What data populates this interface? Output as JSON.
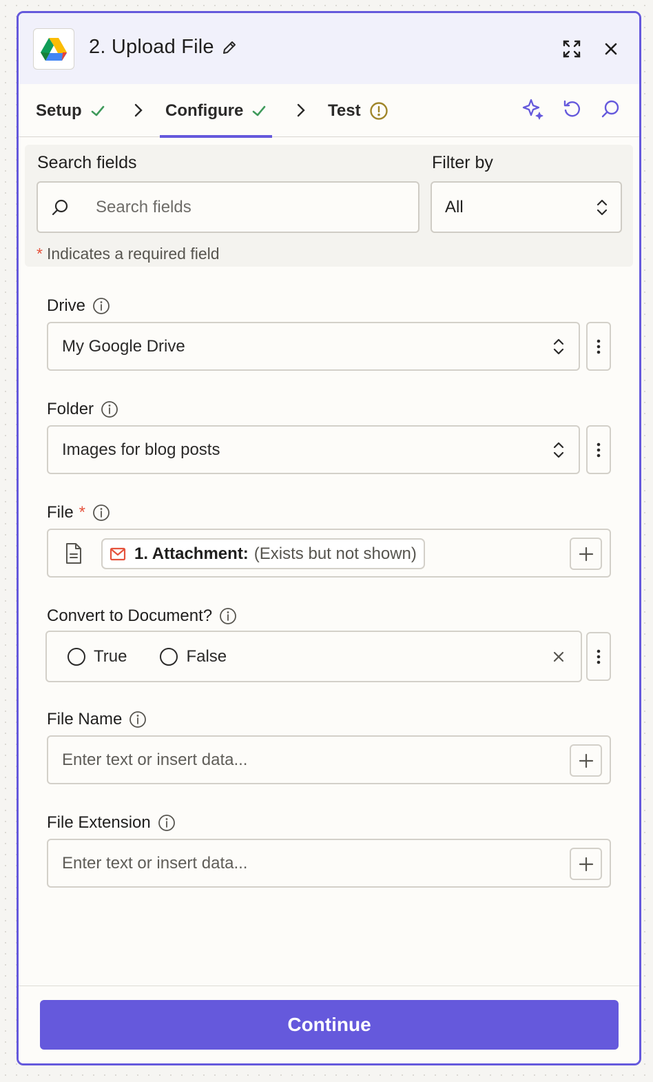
{
  "header": {
    "title": "2. Upload File",
    "app_icon": "google-drive-logo",
    "actions": [
      "expand-icon",
      "close-icon"
    ]
  },
  "tabs": [
    {
      "label": "Setup",
      "status": "complete"
    },
    {
      "label": "Configure",
      "status": "complete",
      "active": true
    },
    {
      "label": "Test",
      "status": "warning"
    }
  ],
  "toolbar": [
    "ai-sparkle-icon",
    "refresh-icon",
    "search-icon"
  ],
  "search": {
    "label": "Search fields",
    "placeholder": "Search fields",
    "filter_label": "Filter by",
    "filter_value": "All",
    "required_note": "Indicates a required field",
    "required_marker": "*"
  },
  "fields": {
    "drive": {
      "label": "Drive",
      "value": "My Google Drive"
    },
    "folder": {
      "label": "Folder",
      "value": "Images for blog posts"
    },
    "file": {
      "label": "File",
      "required_marker": "*",
      "pill_key": "1. Attachment:",
      "pill_value": "(Exists but not shown)"
    },
    "convert": {
      "label": "Convert to Document?",
      "options": [
        "True",
        "False"
      ],
      "clear_symbol": "×"
    },
    "file_name": {
      "label": "File Name",
      "placeholder": "Enter text or insert data..."
    },
    "file_extension": {
      "label": "File Extension",
      "placeholder": "Enter text or insert data..."
    }
  },
  "footer": {
    "continue_label": "Continue"
  },
  "colors": {
    "accent": "#6559dc",
    "check": "#3f9a5b",
    "warning": "#a0862a",
    "required": "#e5533d",
    "gmail": "#e5533d"
  }
}
